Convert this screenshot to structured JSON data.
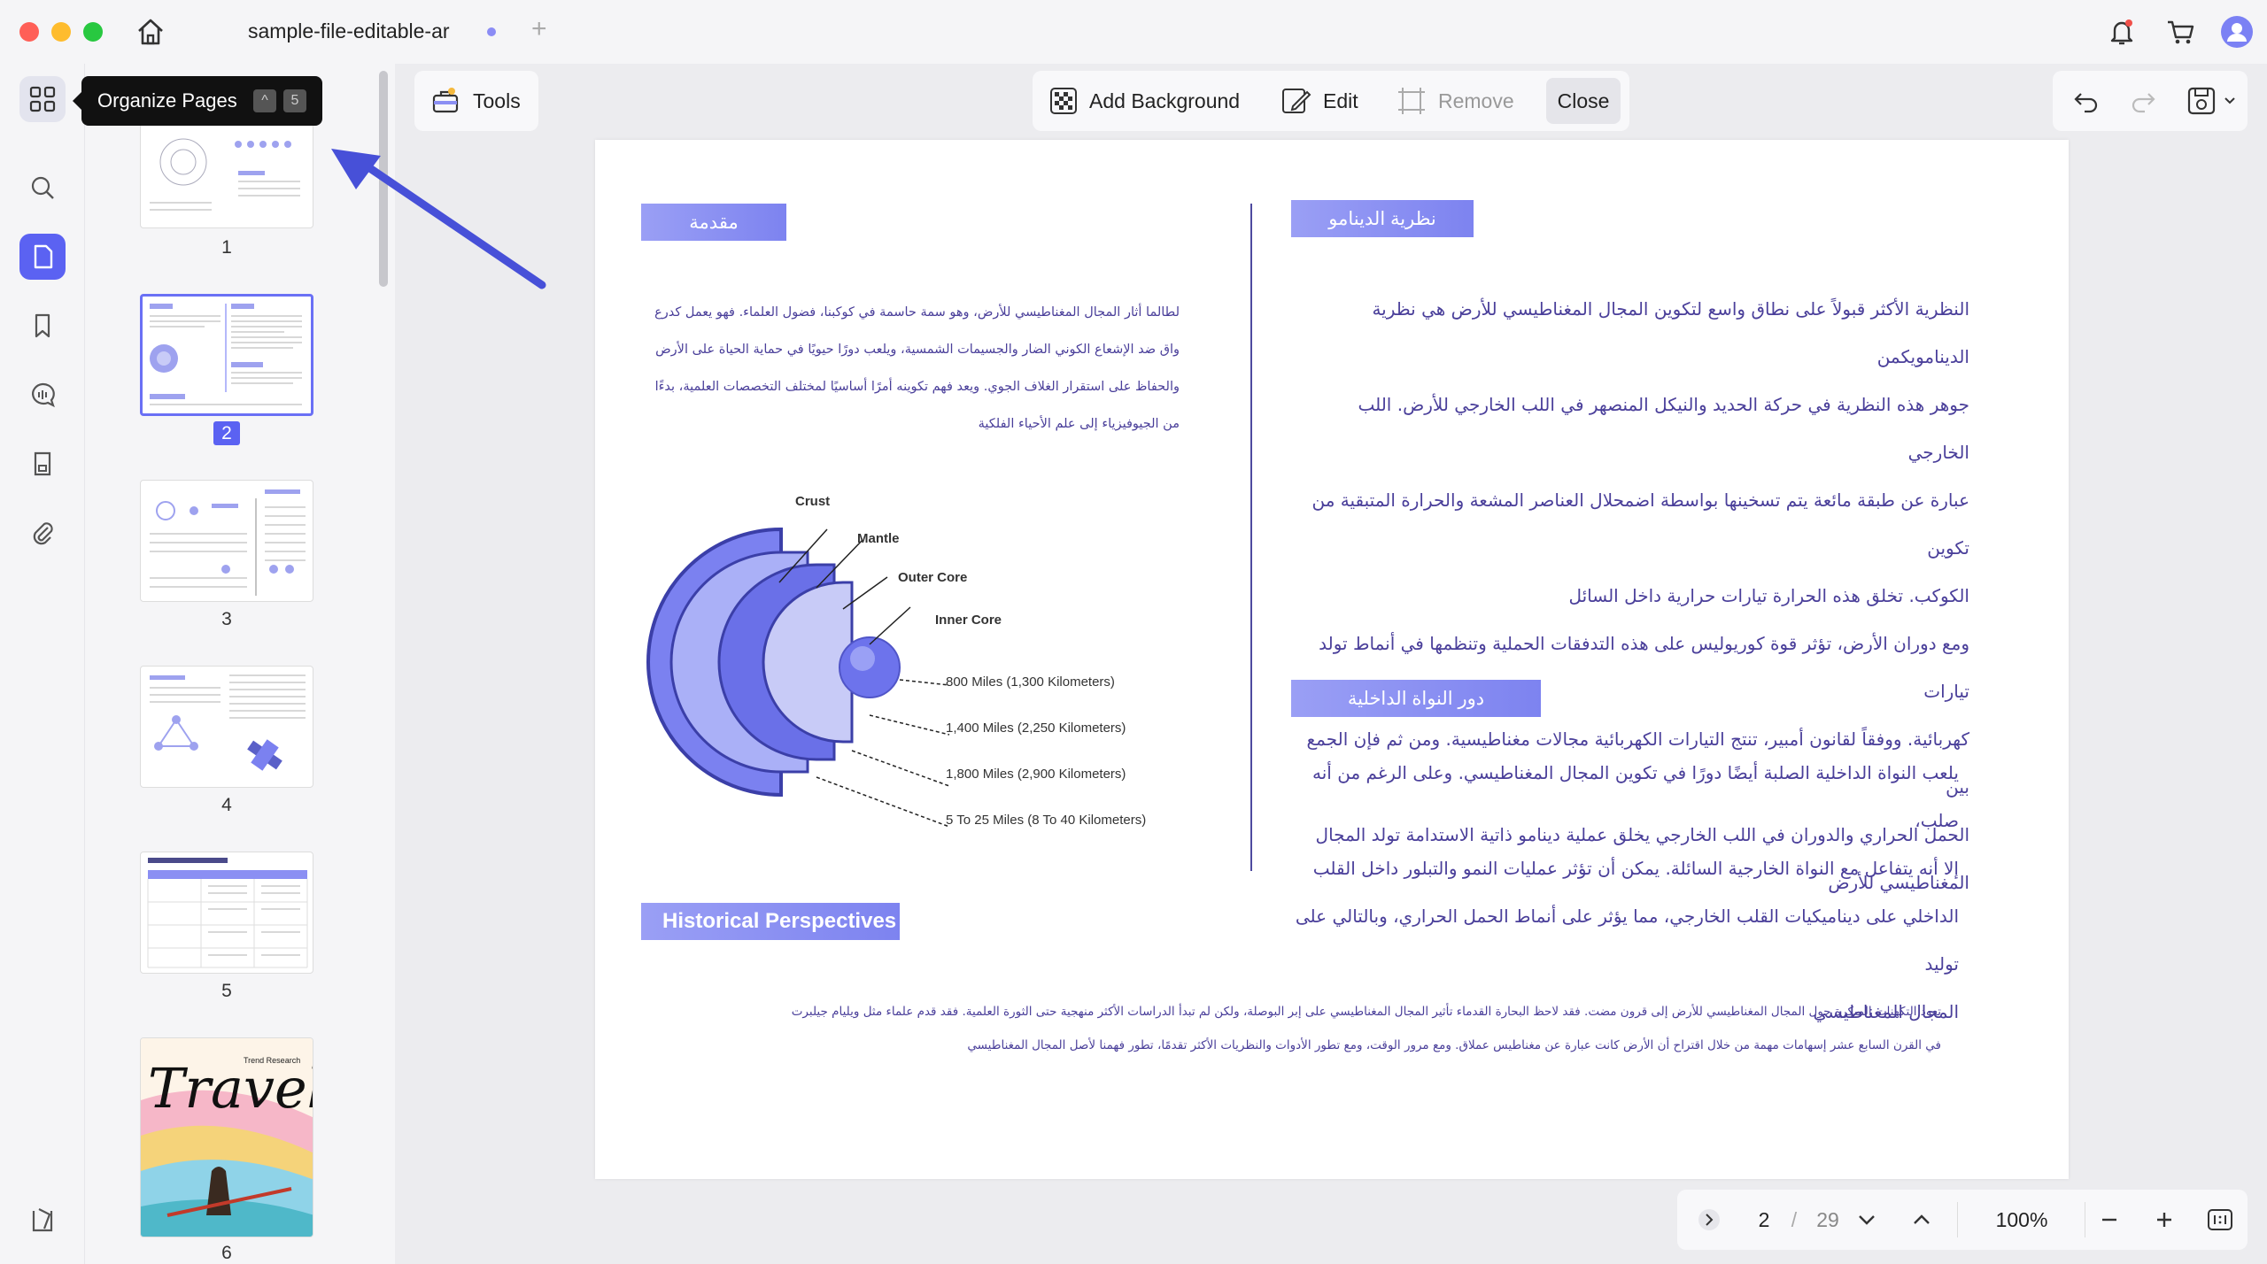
{
  "window": {
    "tab_title": "sample-file-editable-ar",
    "colors": {
      "accent": "#5b62f2",
      "heading_bg": "#8b8ff3",
      "arabic_text": "#4a3f9a",
      "annotation_arrow": "#4750d8"
    }
  },
  "tooltip": {
    "label": "Organize Pages",
    "keys": [
      "^",
      "5"
    ]
  },
  "thumbnails": [
    {
      "number": "1"
    },
    {
      "number": "2",
      "selected": true
    },
    {
      "number": "3"
    },
    {
      "number": "4"
    },
    {
      "number": "5"
    },
    {
      "number": "6",
      "travel_title": "Travel",
      "travel_subtitle": "Trend Research"
    }
  ],
  "toolbar": {
    "tools_label": "Tools",
    "add_background_label": "Add Background",
    "edit_label": "Edit",
    "remove_label": "Remove",
    "close_label": "Close"
  },
  "document": {
    "left": {
      "heading": "مقدمة",
      "paragraph": [
        "لطالما أثار المجال المغناطيسي للأرض، وهو سمة حاسمة في كوكبنا، فضول العلماء. فهو يعمل كدرع",
        "واق ضد الإشعاع الكوني الضار والجسيمات الشمسية، ويلعب دورًا حيويًا في حماية الحياة على الأرض",
        "والحفاظ على استقرار الغلاف الجوي. ويعد فهم تكوينه أمرًا أساسيًا لمختلف التخصصات العلمية، بدءًا",
        "من الجيوفيزياء إلى علم الأحياء الفلكية"
      ],
      "diagram": {
        "labels": [
          "Crust",
          "Mantle",
          "Outer Core",
          "Inner Core"
        ],
        "depths": [
          "800 Miles (1,300 Kilometers)",
          "1,400 Miles (2,250 Kilometers)",
          "1,800 Miles (2,900 Kilometers)",
          "5 To 25 Miles (8 To 40 Kilometers)"
        ]
      },
      "history_heading": "Historical Perspectives",
      "history_paragraph": [
        "تعود التكهنات المبكرة حول المجال المغناطيسي للأرض إلى قرون مضت. فقد لاحظ البحارة القدماء تأثير المجال المغناطيسي على إبر البوصلة، ولكن لم تبدأ الدراسات الأكثر منهجية حتى الثورة العلمية. فقد قدم علماء مثل ويليام جيلبرت",
        "في القرن السابع عشر إسهامات مهمة من خلال اقتراح أن الأرض كانت عبارة عن مغناطيس عملاق. ومع مرور الوقت، ومع تطور الأدوات والنظريات الأكثر تقدمًا، تطور فهمنا لأصل المجال المغناطيسي"
      ]
    },
    "right": {
      "heading": "نظرية الدينامو",
      "paragraph": [
        "النظرية الأكثر قبولاً على نطاق واسع لتكوين المجال المغناطيسي للأرض هي نظرية الدينامويكمن",
        "جوهر هذه النظرية في حركة الحديد والنيكل المنصهر في اللب الخارجي للأرض. اللب الخارجي",
        "عبارة عن طبقة مائعة يتم تسخينها بواسطة اضمحلال العناصر المشعة والحرارة المتبقية من تكوين",
        "الكوكب. تخلق هذه الحرارة تيارات حرارية داخل السائل",
        "ومع دوران الأرض، تؤثر قوة كوريوليس على هذه التدفقات الحملية وتنظمها في أنماط تولد تيارات",
        "كهربائية. ووفقاً لقانون أمبير، تنتج التيارات الكهربائية مجالات مغناطيسية. ومن ثم فإن الجمع بين",
        "الحمل الحراري والدوران في اللب الخارجي يخلق عملية دينامو ذاتية الاستدامة تولد المجال",
        "المغناطيسي للأرض"
      ],
      "heading2": "دور النواة الداخلية",
      "paragraph2": [
        "يلعب النواة الداخلية الصلبة أيضًا دورًا في تكوين المجال المغناطيسي. وعلى الرغم من أنه صلب،",
        "إلا أنه يتفاعل مع النواة الخارجية السائلة. يمكن أن تؤثر عمليات النمو والتبلور داخل القلب",
        "الداخلي على ديناميكيات القلب الخارجي، مما يؤثر على أنماط الحمل الحراري، وبالتالي على توليد",
        "المجال المغناطيسي"
      ]
    }
  },
  "navigation": {
    "current_page": "2",
    "separator": "/",
    "total_pages": "29",
    "zoom": "100%"
  }
}
